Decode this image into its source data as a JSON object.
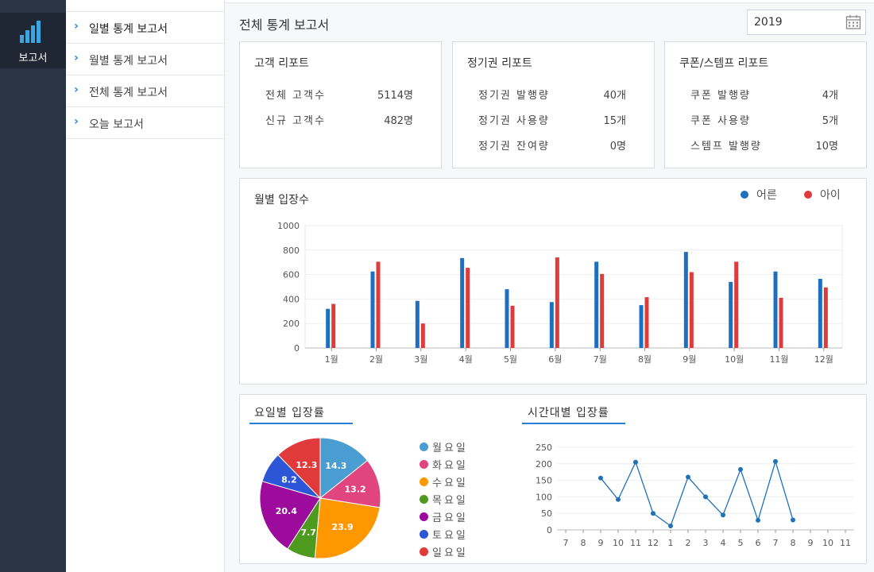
{
  "rail": {
    "report_label": "보고서",
    "icon": "bar-chart-icon"
  },
  "submenu": {
    "items": [
      {
        "label": "일별 통계 보고서",
        "active": true
      },
      {
        "label": "월별 통계 보고서",
        "active": false
      },
      {
        "label": "전체 통계 보고서",
        "active": false
      },
      {
        "label": "오늘 보고서",
        "active": false
      }
    ]
  },
  "header": {
    "title": "전체 통계 보고서",
    "year": "2019",
    "calendar_icon": "calendar-icon"
  },
  "cards": [
    {
      "title": "고객 리포트",
      "rows": [
        {
          "label": "전체 고객수",
          "value": "5114명"
        },
        {
          "label": "신규 고객수",
          "value": "482명"
        }
      ]
    },
    {
      "title": "정기권 리포트",
      "rows": [
        {
          "label": "정기권 발행량",
          "value": "40개"
        },
        {
          "label": "정기권 사용량",
          "value": "15개"
        },
        {
          "label": "정기권 잔여량",
          "value": "0명"
        }
      ]
    },
    {
      "title": "쿠폰/스템프 리포트",
      "rows": [
        {
          "label": "쿠폰 발행량",
          "value": "4개"
        },
        {
          "label": "쿠폰 사용량",
          "value": "5개"
        },
        {
          "label": "스템프 발행량",
          "value": "10명"
        }
      ]
    }
  ],
  "colors": {
    "adult": "#1f6fc0",
    "child": "#e03b3b",
    "accent": "#2a7fd6",
    "line": "#1f72b8"
  },
  "chart_data": [
    {
      "type": "bar",
      "title": "월별 입장수",
      "categories": [
        "1월",
        "2월",
        "3월",
        "4월",
        "5월",
        "6월",
        "7월",
        "8월",
        "9월",
        "10월",
        "11월",
        "12월"
      ],
      "series": [
        {
          "name": "어른",
          "values": [
            320,
            625,
            385,
            735,
            480,
            375,
            705,
            350,
            785,
            540,
            625,
            565
          ]
        },
        {
          "name": "아이",
          "values": [
            360,
            705,
            200,
            655,
            345,
            740,
            605,
            415,
            620,
            705,
            410,
            495
          ]
        }
      ],
      "ylim": [
        0,
        1000
      ],
      "yticks": [
        0,
        200,
        400,
        600,
        800,
        1000
      ],
      "legend": "top-right",
      "grid": true
    },
    {
      "type": "pie",
      "title": "요일별 입장률",
      "labels": [
        "월요일",
        "화요일",
        "수요일",
        "목요일",
        "금요일",
        "토요일",
        "일요일"
      ],
      "values": [
        14.3,
        13.2,
        23.9,
        7.7,
        20.4,
        8.2,
        12.3
      ],
      "colors": [
        "#4a9dd0",
        "#e0457f",
        "#ff9800",
        "#4e9a1f",
        "#9c0b9b",
        "#2d56d6",
        "#e03a3a"
      ],
      "legend": "right"
    },
    {
      "type": "line",
      "title": "시간대별 입장률",
      "xticks": [
        "7",
        "8",
        "9",
        "10",
        "11",
        "12",
        "1",
        "2",
        "3",
        "4",
        "5",
        "6",
        "7",
        "8",
        "9",
        "10",
        "11"
      ],
      "x": [
        "9",
        "10",
        "11",
        "12",
        "1",
        "2",
        "3",
        "4",
        "5",
        "6",
        "7",
        "8"
      ],
      "values": [
        157,
        92,
        205,
        50,
        12,
        160,
        100,
        45,
        183,
        29,
        207,
        30
      ],
      "ylim": [
        0,
        250
      ],
      "yticks": [
        0,
        50,
        100,
        150,
        200,
        250
      ],
      "grid": true
    }
  ]
}
